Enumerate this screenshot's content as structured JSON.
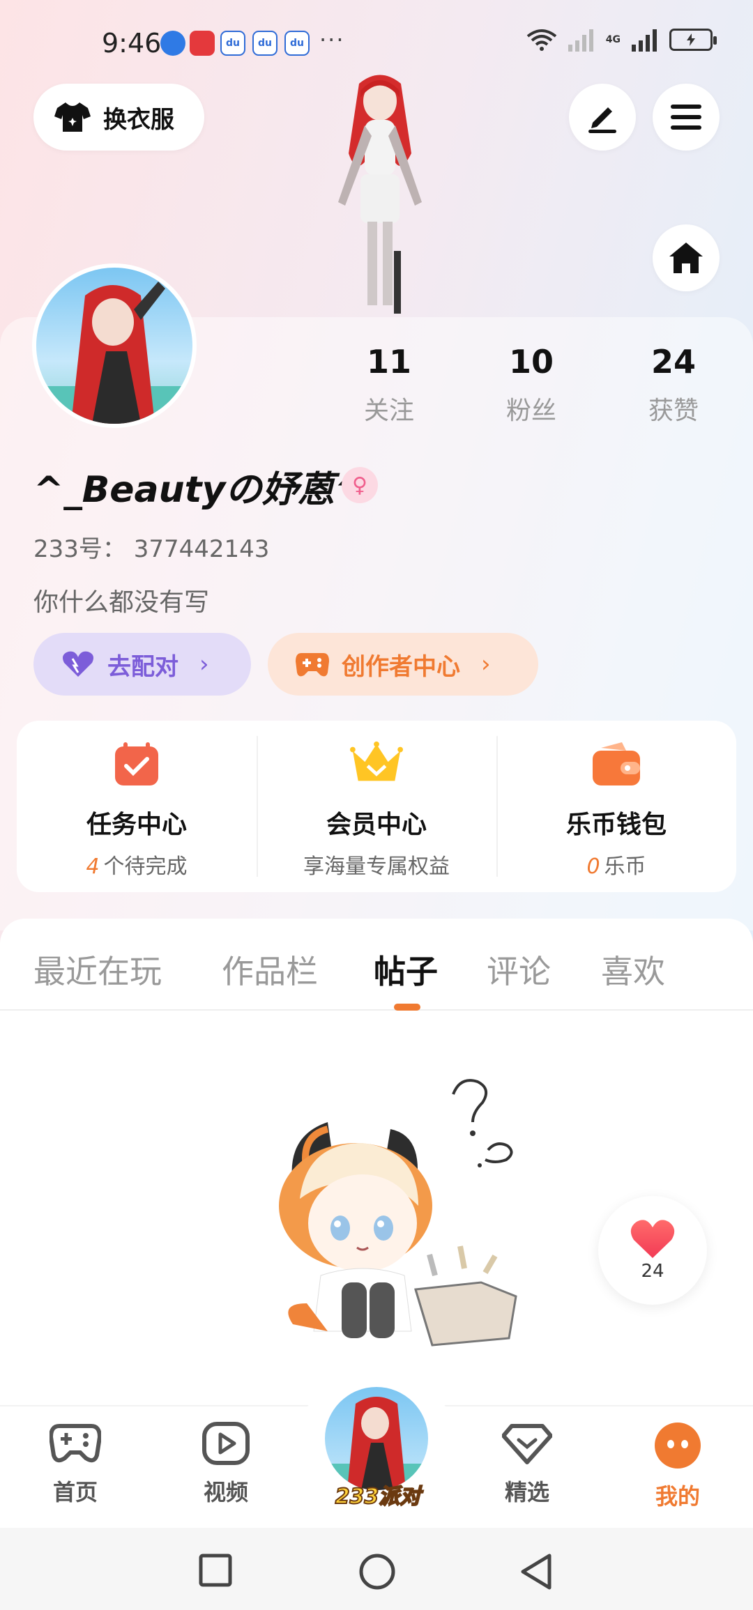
{
  "status_bar": {
    "time": "9:46",
    "more": "···",
    "net_label": "4G",
    "colors": {
      "app_blue": "#2f7ae5",
      "app_red": "#e4393c",
      "app_baidu": "#2e6bd7"
    }
  },
  "top": {
    "dress_label": "换衣服",
    "icons": {
      "dress": "shirt-icon",
      "edit": "pen-icon",
      "menu": "menu-icon",
      "home": "home-icon"
    }
  },
  "profile": {
    "nickname": "^_Beautyの妤蒽^",
    "gender_symbol": "♀",
    "uid": "233号： 377442143",
    "bio": "你什么都没有写",
    "stats": [
      {
        "num": "11",
        "label": "关注"
      },
      {
        "num": "10",
        "label": "粉丝"
      },
      {
        "num": "24",
        "label": "获赞"
      }
    ],
    "match_label": "去配对",
    "creator_label": "创作者中心",
    "chevron": "›"
  },
  "features": [
    {
      "title": "任务中心",
      "highlight": "4",
      "sub": "个待完成",
      "icon": "task-calendar-icon"
    },
    {
      "title": "会员中心",
      "highlight": "",
      "sub": "享海量专属权益",
      "icon": "crown-icon"
    },
    {
      "title": "乐币钱包",
      "highlight": "0",
      "sub": "乐币",
      "icon": "wallet-icon"
    }
  ],
  "tabs": [
    {
      "label": "最近在玩"
    },
    {
      "label": "作品栏"
    },
    {
      "label": "帖子"
    },
    {
      "label": "评论"
    },
    {
      "label": "喜欢"
    }
  ],
  "like_fab": {
    "count": "24"
  },
  "bottom_nav": [
    {
      "label": "首页",
      "icon": "gamepad-icon"
    },
    {
      "label": "视频",
      "icon": "play-icon"
    },
    {
      "label": "233派对",
      "icon": "party-avatar"
    },
    {
      "label": "精选",
      "icon": "heart-diamond-icon"
    },
    {
      "label": "我的",
      "icon": "smile-icon"
    }
  ],
  "colors": {
    "accent": "#f07a31",
    "purple": "#7c5dd9",
    "pink": "#f05e8c"
  }
}
